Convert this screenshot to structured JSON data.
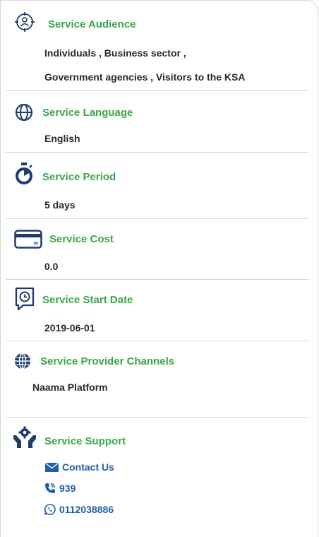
{
  "audience": {
    "title": "Service Audience",
    "line1": "Individuals , Business sector ,",
    "line2": "Government agencies , Visitors to the KSA"
  },
  "language": {
    "title": "Service Language",
    "value": "English"
  },
  "period": {
    "title": "Service Period",
    "value": "5 days"
  },
  "cost": {
    "title": "Service Cost",
    "value": "0.0"
  },
  "start_date": {
    "title": "Service Start Date",
    "value": "2019-06-01"
  },
  "channels": {
    "title": "Service Provider Channels",
    "value": "Naama Platform"
  },
  "support": {
    "title": "Service Support",
    "contact_label": "Contact Us",
    "phone": "939",
    "whatsapp": "0112038886"
  },
  "colors": {
    "accent_green": "#3aa64b",
    "link_blue": "#1f5fa8",
    "icon_navy": "#1e3a6e"
  }
}
